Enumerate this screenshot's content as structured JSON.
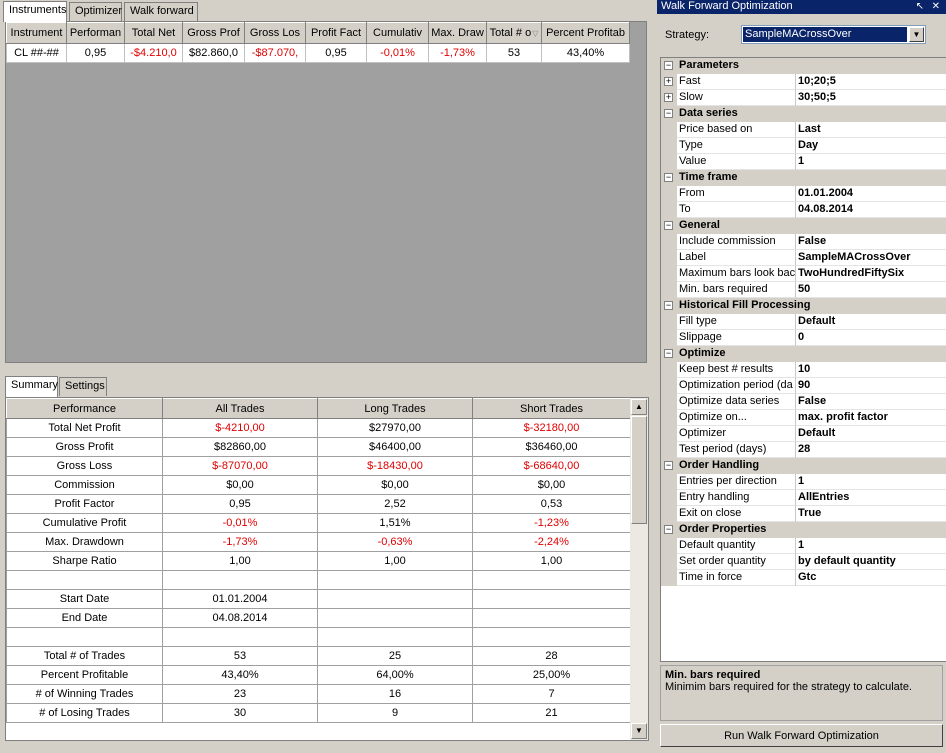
{
  "top_tabs": [
    "Instruments",
    "Optimizer",
    "Walk forward"
  ],
  "instruments_table": {
    "columns": [
      "Instrument",
      "Performan",
      "Total Net",
      "Gross Prof",
      "Gross Los",
      "Profit Fact",
      "Cumulativ",
      "Max. Draw",
      "Total # o",
      "Percent Profitab"
    ],
    "row": [
      "CL ##-##",
      "0,95",
      "-$4.210,0",
      "$82.860,0",
      "-$87.070,",
      "0,95",
      "-0,01%",
      "-1,73%",
      "53",
      "43,40%"
    ]
  },
  "bottom_tabs": [
    "Summary",
    "Settings"
  ],
  "summary_table": {
    "columns": [
      "Performance",
      "All Trades",
      "Long Trades",
      "Short Trades"
    ],
    "rows": [
      [
        "Total Net Profit",
        "$-4210,00",
        "$27970,00",
        "$-32180,00"
      ],
      [
        "Gross Profit",
        "$82860,00",
        "$46400,00",
        "$36460,00"
      ],
      [
        "Gross Loss",
        "$-87070,00",
        "$-18430,00",
        "$-68640,00"
      ],
      [
        "Commission",
        "$0,00",
        "$0,00",
        "$0,00"
      ],
      [
        "Profit Factor",
        "0,95",
        "2,52",
        "0,53"
      ],
      [
        "Cumulative Profit",
        "-0,01%",
        "1,51%",
        "-1,23%"
      ],
      [
        "Max. Drawdown",
        "-1,73%",
        "-0,63%",
        "-2,24%"
      ],
      [
        "Sharpe Ratio",
        "1,00",
        "1,00",
        "1,00"
      ],
      [
        "",
        "",
        "",
        ""
      ],
      [
        "Start Date",
        "01.01.2004",
        "",
        ""
      ],
      [
        "End Date",
        "04.08.2014",
        "",
        ""
      ],
      [
        "",
        "",
        "",
        ""
      ],
      [
        "Total # of Trades",
        "53",
        "25",
        "28"
      ],
      [
        "Percent Profitable",
        "43,40%",
        "64,00%",
        "25,00%"
      ],
      [
        "# of Winning Trades",
        "23",
        "16",
        "7"
      ],
      [
        "# of Losing Trades",
        "30",
        "9",
        "21"
      ]
    ]
  },
  "panel": {
    "title": "Walk Forward Optimization",
    "pin_glyph": "↖",
    "close_glyph": "✕",
    "strategy_label": "Strategy:",
    "strategy_value": "SampleMACrossOver",
    "run_button": "Run Walk Forward Optimization",
    "description_title": "Min. bars required",
    "description_text": "Minimim bars required for the strategy to calculate."
  },
  "property_grid": [
    {
      "section": "Parameters",
      "items": [
        {
          "name": "Fast",
          "value": "10;20;5",
          "expand": true
        },
        {
          "name": "Slow",
          "value": "30;50;5",
          "expand": true
        }
      ]
    },
    {
      "section": "Data series",
      "items": [
        {
          "name": "Price based on",
          "value": "Last"
        },
        {
          "name": "Type",
          "value": "Day"
        },
        {
          "name": "Value",
          "value": "1"
        }
      ]
    },
    {
      "section": "Time frame",
      "items": [
        {
          "name": "From",
          "value": "01.01.2004"
        },
        {
          "name": "To",
          "value": "04.08.2014"
        }
      ]
    },
    {
      "section": "General",
      "items": [
        {
          "name": "Include commission",
          "value": "False"
        },
        {
          "name": "Label",
          "value": "SampleMACrossOver"
        },
        {
          "name": "Maximum bars look bac",
          "value": "TwoHundredFiftySix"
        },
        {
          "name": "Min. bars required",
          "value": "50"
        }
      ]
    },
    {
      "section": "Historical Fill Processing",
      "items": [
        {
          "name": "Fill type",
          "value": "Default"
        },
        {
          "name": "Slippage",
          "value": "0"
        }
      ]
    },
    {
      "section": "Optimize",
      "items": [
        {
          "name": "Keep best # results",
          "value": "10"
        },
        {
          "name": "Optimization period (da",
          "value": "90"
        },
        {
          "name": "Optimize data series",
          "value": "False"
        },
        {
          "name": "Optimize on...",
          "value": "max. profit factor"
        },
        {
          "name": "Optimizer",
          "value": "Default"
        },
        {
          "name": "Test period (days)",
          "value": "28"
        }
      ]
    },
    {
      "section": "Order Handling",
      "items": [
        {
          "name": "Entries per direction",
          "value": "1"
        },
        {
          "name": "Entry handling",
          "value": "AllEntries"
        },
        {
          "name": "Exit on close",
          "value": "True"
        }
      ]
    },
    {
      "section": "Order Properties",
      "items": [
        {
          "name": "Default quantity",
          "value": "1"
        },
        {
          "name": "Set order quantity",
          "value": "by default quantity"
        },
        {
          "name": "Time in force",
          "value": "Gtc"
        }
      ]
    }
  ],
  "colors": {
    "negative": "#e00000",
    "title_bar": "#0a246a",
    "selection": "#0a246a"
  }
}
